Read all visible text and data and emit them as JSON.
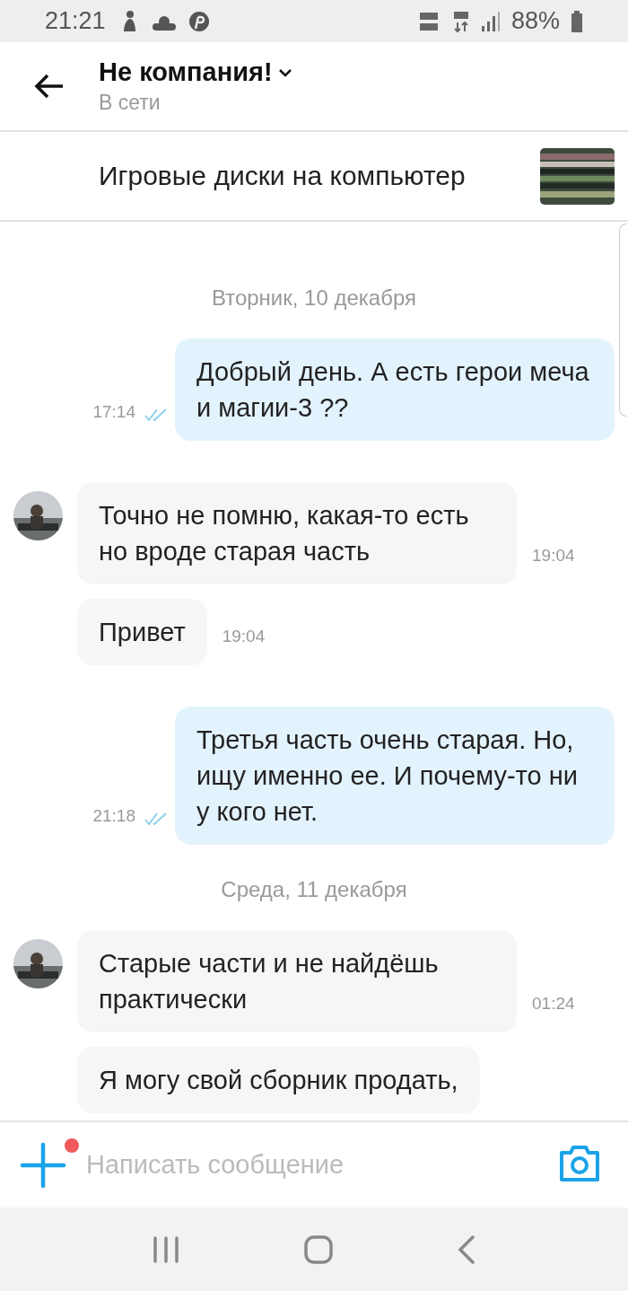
{
  "status_bar": {
    "time": "21:21",
    "battery": "88%"
  },
  "header": {
    "title": "Не компания!",
    "subtitle": "В сети"
  },
  "listing": {
    "title": "Игровые диски на компьютер"
  },
  "messages": [
    {
      "kind": "date",
      "text": "Вторник, 10 декабря"
    },
    {
      "kind": "outgoing",
      "text": "Добрый день. А есть герои меча и магии-3 ??",
      "time": "17:14",
      "read": true
    },
    {
      "kind": "incoming",
      "text": "Точно не помню, какая-то есть но вроде старая часть",
      "time": "19:04",
      "avatar": true
    },
    {
      "kind": "incoming",
      "text": "Привет",
      "time": "19:04",
      "avatar": false
    },
    {
      "kind": "outgoing",
      "text": "Третья часть очень старая. Но, ищу именно ее. И почему-то ни у кого нет.",
      "time": "21:18",
      "read": true
    },
    {
      "kind": "date",
      "text": "Среда, 11 декабря"
    },
    {
      "kind": "incoming",
      "text": "Старые части и не найдёшь практически",
      "time": "01:24",
      "avatar": true
    },
    {
      "kind": "incoming",
      "text": "Я могу свой сборник продать,",
      "avatar": false
    }
  ],
  "composer": {
    "placeholder": "Написать сообщение",
    "attachment_badge": true
  }
}
